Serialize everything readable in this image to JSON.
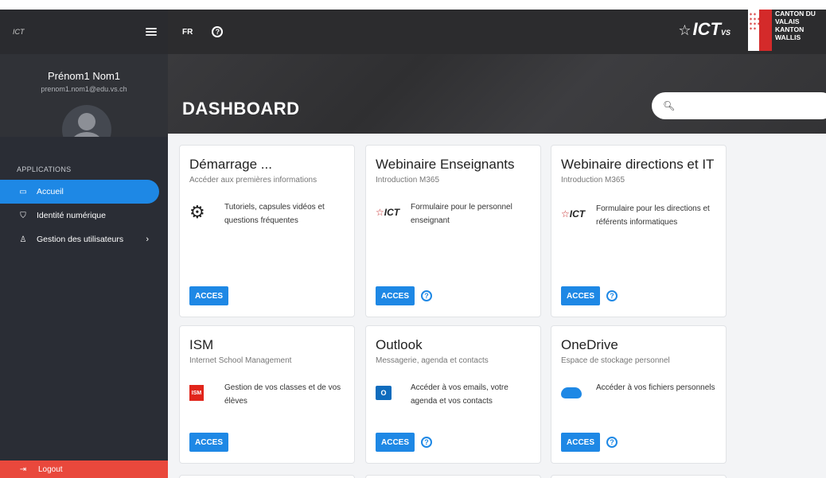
{
  "sidebar": {
    "logo": "ICT",
    "user": {
      "name": "Prénom1 Nom1",
      "email": "prenom1.nom1@edu.vs.ch"
    },
    "section_label": "APPLICATIONS",
    "items": [
      {
        "label": "Accueil",
        "icon": "screen-icon",
        "active": true
      },
      {
        "label": "Identité numérique",
        "icon": "shield-check-icon",
        "active": false
      },
      {
        "label": "Gestion des utilisateurs",
        "icon": "user-icon",
        "active": false,
        "has_chevron": true
      }
    ],
    "logout_label": "Logout"
  },
  "topbar": {
    "language": "FR",
    "canton_line1": "CANTON DU VALAIS",
    "canton_line2": "KANTON WALLIS"
  },
  "header": {
    "title": "DASHBOARD",
    "search_placeholder": ""
  },
  "cards": [
    {
      "title": "Démarrage ...",
      "subtitle": "Accéder aux premières informations",
      "desc": "Tutoriels, capsules vidéos et questions fréquentes",
      "icon": "gear-hand-icon",
      "button": "ACCES",
      "help": false
    },
    {
      "title": "Webinaire Enseignants",
      "subtitle": "Introduction M365",
      "desc": "Formulaire pour le personnel enseignant",
      "icon": "ict-logo-icon",
      "button": "ACCES",
      "help": true
    },
    {
      "title": "Webinaire directions et IT",
      "subtitle": "Introduction M365",
      "desc": "Formulaire pour les directions et référents informatiques",
      "icon": "ict-logo-icon",
      "button": "ACCES",
      "help": true
    },
    {
      "title": "ISM",
      "subtitle": "Internet School Management",
      "desc": "Gestion de vos classes et de vos élèves",
      "icon": "ism-icon",
      "button": "ACCES",
      "help": false
    },
    {
      "title": "Outlook",
      "subtitle": "Messagerie, agenda et contacts",
      "desc": "Accéder à vos emails, votre agenda et vos contacts",
      "icon": "outlook-icon",
      "button": "ACCES",
      "help": true
    },
    {
      "title": "OneDrive",
      "subtitle": "Espace de stockage personnel",
      "desc": "Accéder à vos fichiers personnels",
      "icon": "onedrive-icon",
      "button": "ACCES",
      "help": true
    }
  ],
  "colors": {
    "accent": "#1e88e5",
    "logout": "#e9483c",
    "sidebar": "#2a2d35"
  }
}
